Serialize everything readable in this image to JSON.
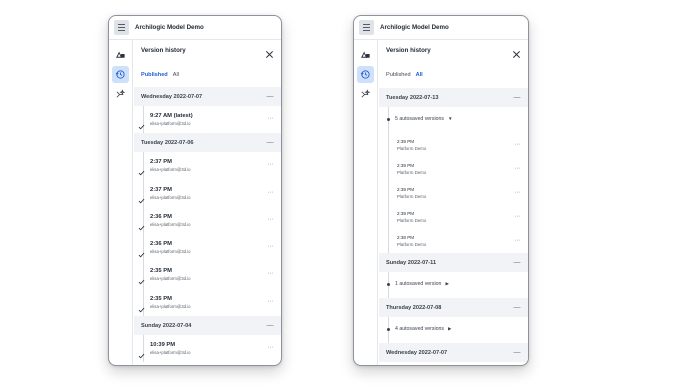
{
  "left_panel": {
    "app_title": "Archilogic Model Demo",
    "panel_title": "Version history",
    "tabs": [
      {
        "label": "Published",
        "active": true
      },
      {
        "label": "All",
        "active": false
      }
    ],
    "groups": [
      {
        "date": "Wednesday 2022-07-07",
        "versions": [
          {
            "time": "9:27 AM (latest)",
            "user": "elisa+platform@3d.io"
          }
        ]
      },
      {
        "date": "Tuesday 2022-07-06",
        "versions": [
          {
            "time": "2:37 PM",
            "user": "elisa+platform@3d.io"
          },
          {
            "time": "2:37 PM",
            "user": "elisa+platform@3d.io"
          },
          {
            "time": "2:36 PM",
            "user": "elisa+platform@3d.io"
          },
          {
            "time": "2:36 PM",
            "user": "elisa+platform@3d.io"
          },
          {
            "time": "2:35 PM",
            "user": "elisa+platform@3d.io"
          },
          {
            "time": "2:35 PM",
            "user": "elisa+platform@3d.io"
          }
        ]
      },
      {
        "date": "Sunday 2022-07-04",
        "versions": [
          {
            "time": "10:39 PM",
            "user": "elisa+platform@3d.io"
          }
        ]
      }
    ]
  },
  "right_panel": {
    "app_title": "Archilogic Model Demo",
    "panel_title": "Version history",
    "tabs": [
      {
        "label": "Published",
        "active": false
      },
      {
        "label": "All",
        "active": true
      }
    ],
    "groups": [
      {
        "date": "Tuesday 2022-07-13",
        "autosave_label": "5 autosaved versions",
        "expanded": true,
        "autosaves": [
          {
            "time": "2:39 PM",
            "user": "Platform Demo"
          },
          {
            "time": "2:39 PM",
            "user": "Platform Demo"
          },
          {
            "time": "2:39 PM",
            "user": "Platform Demo"
          },
          {
            "time": "2:39 PM",
            "user": "Platform Demo"
          },
          {
            "time": "2:38 PM",
            "user": "Platform Demo"
          }
        ]
      },
      {
        "date": "Sunday 2022-07-11",
        "autosave_label": "1 autosaved version",
        "expanded": false
      },
      {
        "date": "Thursday 2022-07-08",
        "autosave_label": "4 autosaved versions",
        "expanded": false
      },
      {
        "date": "Wednesday 2022-07-07"
      }
    ]
  },
  "icons": {
    "menu": "hamburger-icon",
    "rail": [
      "shapes-icon",
      "history-icon",
      "ai-sparkle-icon"
    ],
    "close": "close-icon",
    "more": "more-horizontal-icon",
    "published": "check-icon"
  },
  "colors": {
    "accent": "#1f5fd1",
    "active_rail": "#cfe0fb",
    "date_row": "#f1f3f6"
  }
}
